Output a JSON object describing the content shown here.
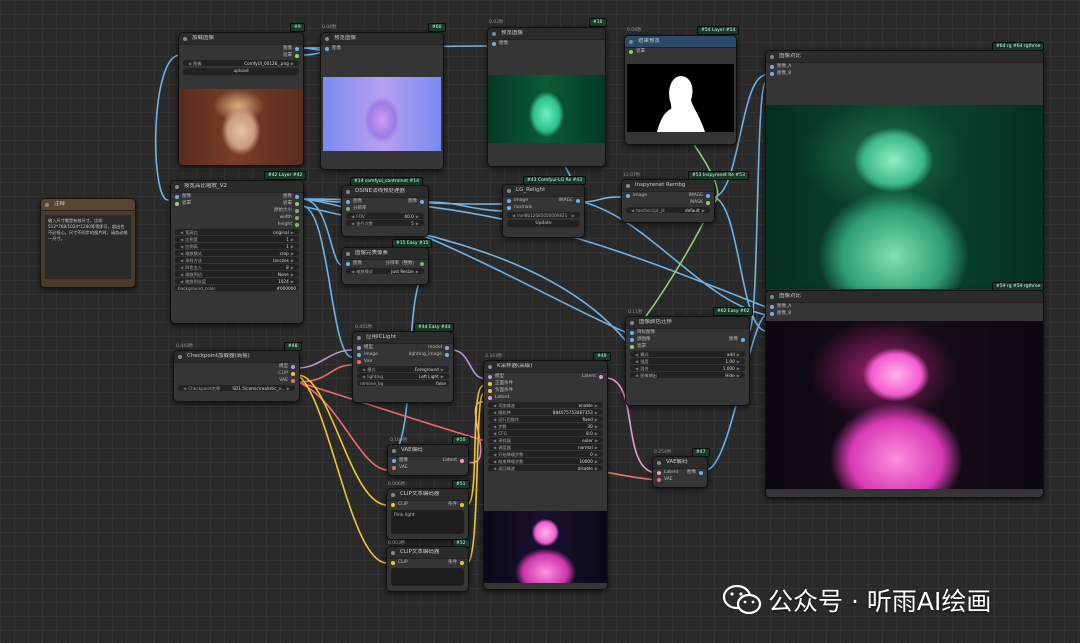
{
  "colors": {
    "image_wire": "#6fb3e8",
    "model_wire": "#b59ad8",
    "clip_wire": "#f2c530",
    "vae_wire": "#f06c6c",
    "latent_wire": "#e89bcf",
    "mask_wire": "#8fd07a",
    "badge_green": "#1a3d2a",
    "node_bg": "#353535"
  },
  "nodes": {
    "load_image": {
      "id": "#9",
      "title": "加载图像",
      "out1": "图像",
      "out2": "遮罩",
      "w_label": "图像",
      "w_value": "ComfyUI_00126_.png",
      "upload": "upload"
    },
    "preview60": {
      "id": "#60",
      "timing": "0.04秒",
      "title": "预览图像",
      "in1": "图像"
    },
    "preview10": {
      "id": "#10",
      "timing": "0.03秒",
      "title": "预览图像",
      "in1": "图像"
    },
    "mask_preview": {
      "id": "#54 Layer #54",
      "timing": "0.04秒",
      "title": "遮罩预览",
      "in1": "遮罩"
    },
    "compare64": {
      "id": "#64 rg #64 rgthree",
      "title": "图像对比",
      "in1": "图像_A",
      "in2": "图像_B"
    },
    "note": {
      "title": "注释",
      "text": "输入尺寸需是有效尺寸。比如512*768/1024*1280等等即可，超出也不必担心。尺寸不同步的图片时，请务必统一尺寸。"
    },
    "scale42": {
      "id": "#42 Layer #42",
      "title": "按宽高比缩放_V2",
      "in1": "图像",
      "in2": "遮罩",
      "outs": [
        "图像",
        "遮罩",
        "原始大小",
        "width",
        "height"
      ],
      "widgets": [
        [
          "宽高比",
          "original"
        ],
        [
          "比例宽",
          "1"
        ],
        [
          "比例高",
          "1"
        ],
        [
          "缩放模式",
          "crop"
        ],
        [
          "采样方法",
          "lanczos"
        ],
        [
          "四舍五入",
          "8"
        ],
        [
          "缩放到边",
          "None"
        ],
        [
          "缩放到长度",
          "1024"
        ],
        [
          "background_color",
          "#000000"
        ]
      ]
    },
    "dsine14": {
      "id": "#14 comfyui_controlnet #14",
      "title": "DSINE法线预处理器",
      "in1": "图像",
      "in2": "分辨率",
      "out1": "图像",
      "widgets": [
        [
          "FOV",
          "60.0"
        ],
        [
          "迭代次数",
          "5"
        ]
      ]
    },
    "lg43": {
      "id": "#43 Comfyui-LG Re #43",
      "title": "LG_Relight",
      "in1": "image",
      "in2": "normals",
      "out1": "IMAGE",
      "w_value": "lnxl8b12685050000821",
      "btn": "Update"
    },
    "inspyrenet53": {
      "id": "#53 Inspyrenet Re #53",
      "timing": "12.07秒",
      "title": "Inspyrenet Rembg",
      "in1": "image",
      "out1": "IMAGE",
      "out2": "MASK",
      "w_label": "torchscript_jit",
      "w_value": "default"
    },
    "resize15": {
      "id": "#15 Easy #15",
      "title": "图像完美像素",
      "in1": "图像",
      "out1": "分辨率（整数）",
      "w_label": "缩放模式",
      "w_value": "Just Resize"
    },
    "color62": {
      "id": "#62 Easy #62",
      "timing": "0.11秒",
      "title": "图像颜色迁移",
      "in1": "目标图像",
      "in2": "源图像",
      "in3": "遮罩",
      "out1": "图像",
      "widgets": [
        [
          "模式",
          "add"
        ],
        [
          "强度",
          "1.00"
        ],
        [
          "混合",
          "1.000"
        ],
        [
          "图像输出",
          "Hide"
        ]
      ]
    },
    "compare59": {
      "id": "#59 rg #59 rgthree",
      "title": "图像对比",
      "in1": "图像_A",
      "in2": "图像_B"
    },
    "checkpoint48": {
      "id": "#48",
      "timing": "0.443秒",
      "title": "Checkpoint加载器(简易)",
      "outs": [
        "模型",
        "CLIP",
        "VAE"
      ],
      "w_label": "Checkpoint名称",
      "w_value": "SD1.5\\comic\\realistic_v..."
    },
    "iclight44": {
      "id": "#44 Easy #44",
      "timing": "0.455秒",
      "title": "应用ICLight",
      "ins": [
        "模型",
        "image",
        "Vae"
      ],
      "outs": [
        "model",
        "lighting_image"
      ],
      "widgets": [
        [
          "模式",
          "Foreground"
        ],
        [
          "lighting",
          "Left Light"
        ],
        [
          "remove_bg",
          "false"
        ]
      ]
    },
    "ksampler49": {
      "id": "#49",
      "timing": "3.343秒",
      "title": "K采样器(高级)",
      "ins": [
        "模型",
        "正面条件",
        "负面条件",
        "Latent"
      ],
      "out1": "Latent",
      "widgets": [
        [
          "添加噪波",
          "enable"
        ],
        [
          "随机种",
          "884075753487353"
        ],
        [
          "运行后操作",
          "fixed"
        ],
        [
          "步数",
          "30"
        ],
        [
          "CFG",
          "8.0"
        ],
        [
          "采样器",
          "euler"
        ],
        [
          "调度器",
          "normal"
        ],
        [
          "开始降噪步数",
          "0"
        ],
        [
          "结束降噪步数",
          "10000"
        ],
        [
          "返回噪波",
          "disable"
        ]
      ]
    },
    "vaedecode47": {
      "id": "#47",
      "timing": "0.254秒",
      "title": "VAE解码",
      "in1": "Latent",
      "in2": "VAE",
      "out1": "图像"
    },
    "vaeencode50": {
      "id": "#50",
      "timing": "0.106秒",
      "title": "VAE编码",
      "in1": "图像",
      "in2": "VAE",
      "out1": "Latent"
    },
    "clip51": {
      "id": "#51",
      "timing": "0.006秒",
      "title": "CLIP文本编码器",
      "in1": "CLIP",
      "out1": "条件",
      "text": "Pink light"
    },
    "clip52": {
      "id": "#52",
      "timing": "0.003秒",
      "title": "CLIP文本编码器",
      "in1": "CLIP",
      "out1": "条件",
      "text": ""
    }
  },
  "watermark": {
    "text": "公众号 · 听雨AI绘画"
  }
}
